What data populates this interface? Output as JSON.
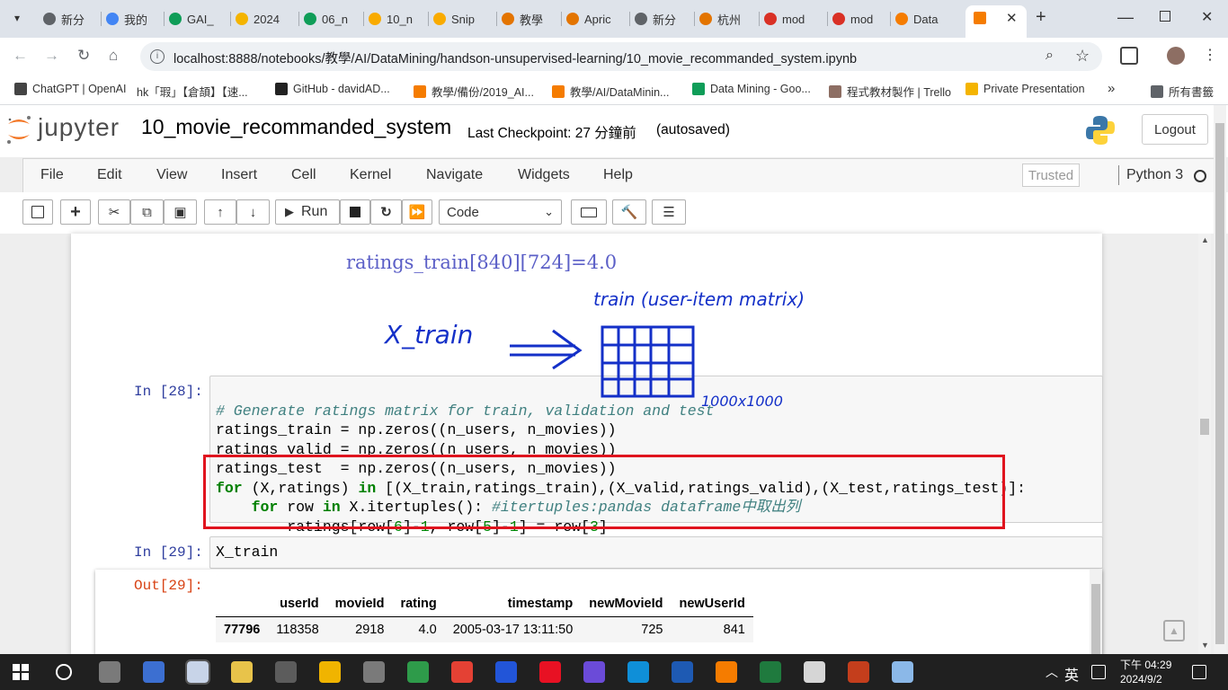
{
  "browser": {
    "tabs": [
      {
        "label": "新分",
        "color": "#5f6368"
      },
      {
        "label": "我的",
        "color": "#4285f4"
      },
      {
        "label": "GAI_",
        "color": "#0f9d58"
      },
      {
        "label": "2024",
        "color": "#f4b400"
      },
      {
        "label": "06_n",
        "color": "#0f9d58"
      },
      {
        "label": "10_n",
        "color": "#f9ab00"
      },
      {
        "label": "Snip",
        "color": "#f9ab00"
      },
      {
        "label": "教學",
        "color": "#e37400"
      },
      {
        "label": "Apric",
        "color": "#e37400"
      },
      {
        "label": "新分",
        "color": "#5f6368"
      },
      {
        "label": "杭州",
        "color": "#e37400"
      },
      {
        "label": "mod",
        "color": "#d93025"
      },
      {
        "label": "mod",
        "color": "#d93025"
      },
      {
        "label": "Data",
        "color": "#f57c00"
      },
      {
        "label": "",
        "color": "#f57c00"
      }
    ],
    "url": "localhost:8888/notebooks/教學/AI/DataMining/handson-unsupervised-learning/10_movie_recommanded_system.ipynb",
    "bookmarks": [
      {
        "label": "ChatGPT | OpenAI"
      },
      {
        "label": "hk「瑕」【倉頡】【速..."
      },
      {
        "label": "GitHub - davidAD..."
      },
      {
        "label": "教學/備份/2019_AI..."
      },
      {
        "label": "教學/AI/DataMinin..."
      },
      {
        "label": "Data Mining - Goo..."
      },
      {
        "label": "程式教材製作 | Trello"
      },
      {
        "label": "Private Presentation"
      },
      {
        "label": "所有書籤"
      }
    ]
  },
  "jupyter": {
    "logo_text": "jupyter",
    "notebook_name": "10_movie_recommanded_system",
    "checkpoint": "Last Checkpoint: 27 分鐘前",
    "autosaved": "(autosaved)",
    "logout": "Logout",
    "menus": [
      "File",
      "Edit",
      "View",
      "Insert",
      "Cell",
      "Kernel",
      "Navigate",
      "Widgets",
      "Help"
    ],
    "trusted": "Trusted",
    "kernel": "Python 3",
    "run_label": "Run",
    "cell_type": "Code"
  },
  "notebook": {
    "markdown_formula": "ratings_train[840][724]=4.0",
    "annotation": {
      "left_label": "X_train",
      "top_label": "train (user-item matrix)",
      "size_label": "1000x1000"
    },
    "cell28": {
      "prompt": "In [28]:",
      "lines": [
        "# Generate ratings matrix for train, validation and test",
        "ratings_train = np.zeros((n_users, n_movies))",
        "ratings_valid = np.zeros((n_users, n_movies))",
        "ratings_test  = np.zeros((n_users, n_movies))",
        "for (X,ratings) in [(X_train,ratings_train),(X_valid,ratings_valid),(X_test,ratings_test)]:",
        "    for row in X.itertuples(): #itertuples:pandas dataframe中取出列",
        "        ratings[row[6]-1, row[5]-1] = row[3]"
      ]
    },
    "cell29": {
      "prompt": "In [29]:",
      "code": "X_train",
      "out_prompt": "Out[29]:",
      "table": {
        "columns": [
          "",
          "userId",
          "movieId",
          "rating",
          "timestamp",
          "newMovieId",
          "newUserId"
        ],
        "rows": [
          [
            "77796",
            "118358",
            "2918",
            "4.0",
            "2005-03-17 13:11:50",
            "725",
            "841"
          ]
        ]
      }
    }
  },
  "taskbar": {
    "ime": "英",
    "time": "下午 04:29",
    "date": "2024/9/2"
  }
}
